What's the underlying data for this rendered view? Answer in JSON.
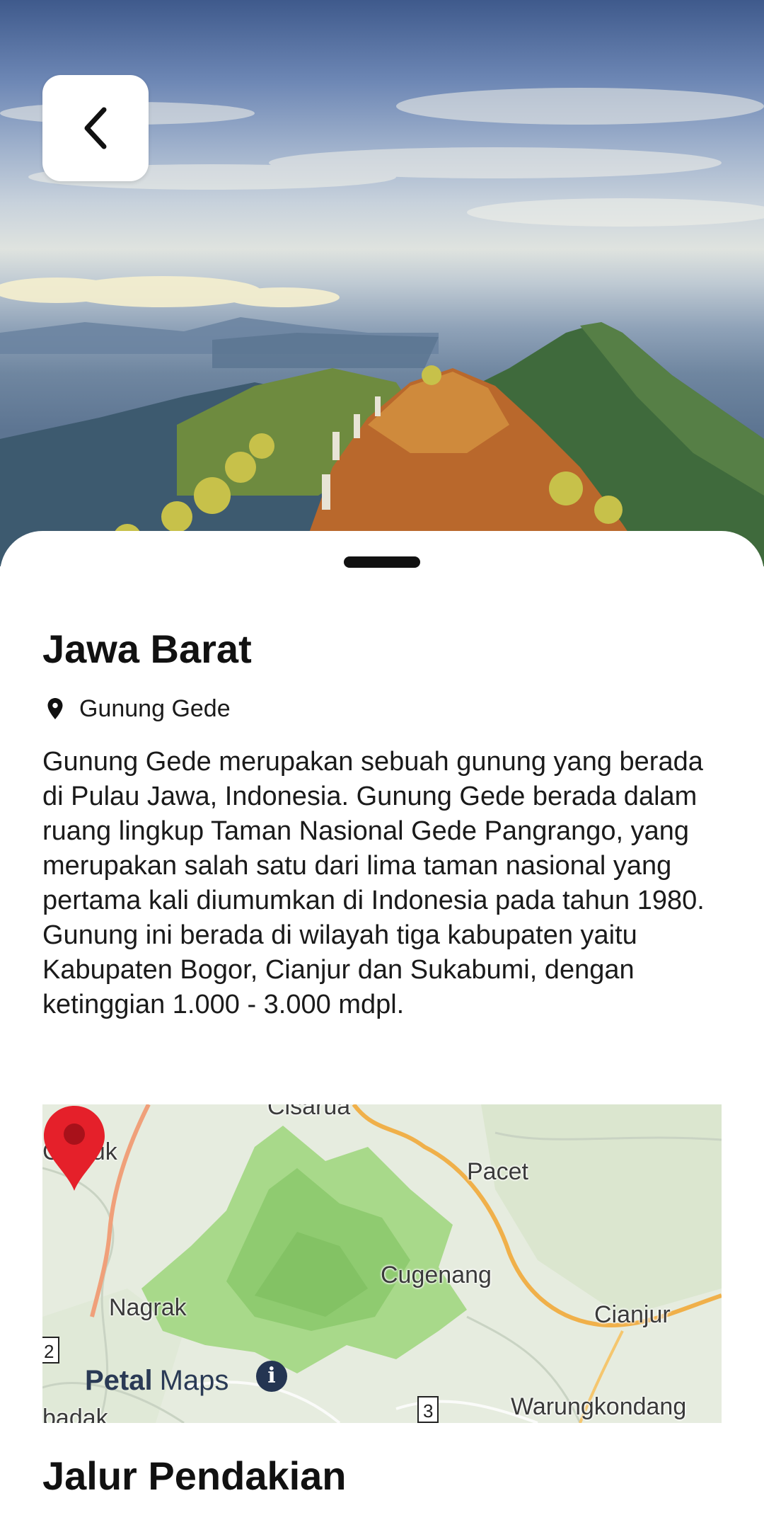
{
  "hero": {
    "image_name": "mountain-landscape-image"
  },
  "back_button": {
    "icon": "chevron-left-icon"
  },
  "detail": {
    "title": "Jawa Barat",
    "location_icon": "location-pin-icon",
    "location": "Gunung Gede",
    "description": "Gunung Gede merupakan sebuah gunung yang berada di Pulau Jawa, Indonesia. Gunung Gede berada dalam ruang lingkup Taman Nasional Gede Pangrango, yang merupakan salah satu dari lima taman nasional yang pertama kali diumumkan di Indonesia pada tahun 1980. Gunung ini berada di wilayah tiga kabupaten yaitu Kabupaten Bogor, Cianjur dan Sukabumi, dengan ketinggian 1.000 - 3.000 mdpl."
  },
  "map": {
    "labels": {
      "cisarua": "Cisarua",
      "cijeruk": "Cijeruk",
      "pacet": "Pacet",
      "cugenang": "Cugenang",
      "nagrak": "Nagrak",
      "cianjur": "Cianjur",
      "warungkondang": "Warungkondang",
      "cibadak": "badak"
    },
    "road_badges": [
      "2",
      "3"
    ],
    "brand_bold": "Petal",
    "brand_regular": "Maps",
    "info_icon": "info-icon",
    "marker_icon": "map-marker-icon",
    "colors": {
      "marker": "#e5202a",
      "forest": "#9fd17c",
      "road": "#f0b04a"
    }
  },
  "section": {
    "title": "Jalur Pendakian"
  }
}
